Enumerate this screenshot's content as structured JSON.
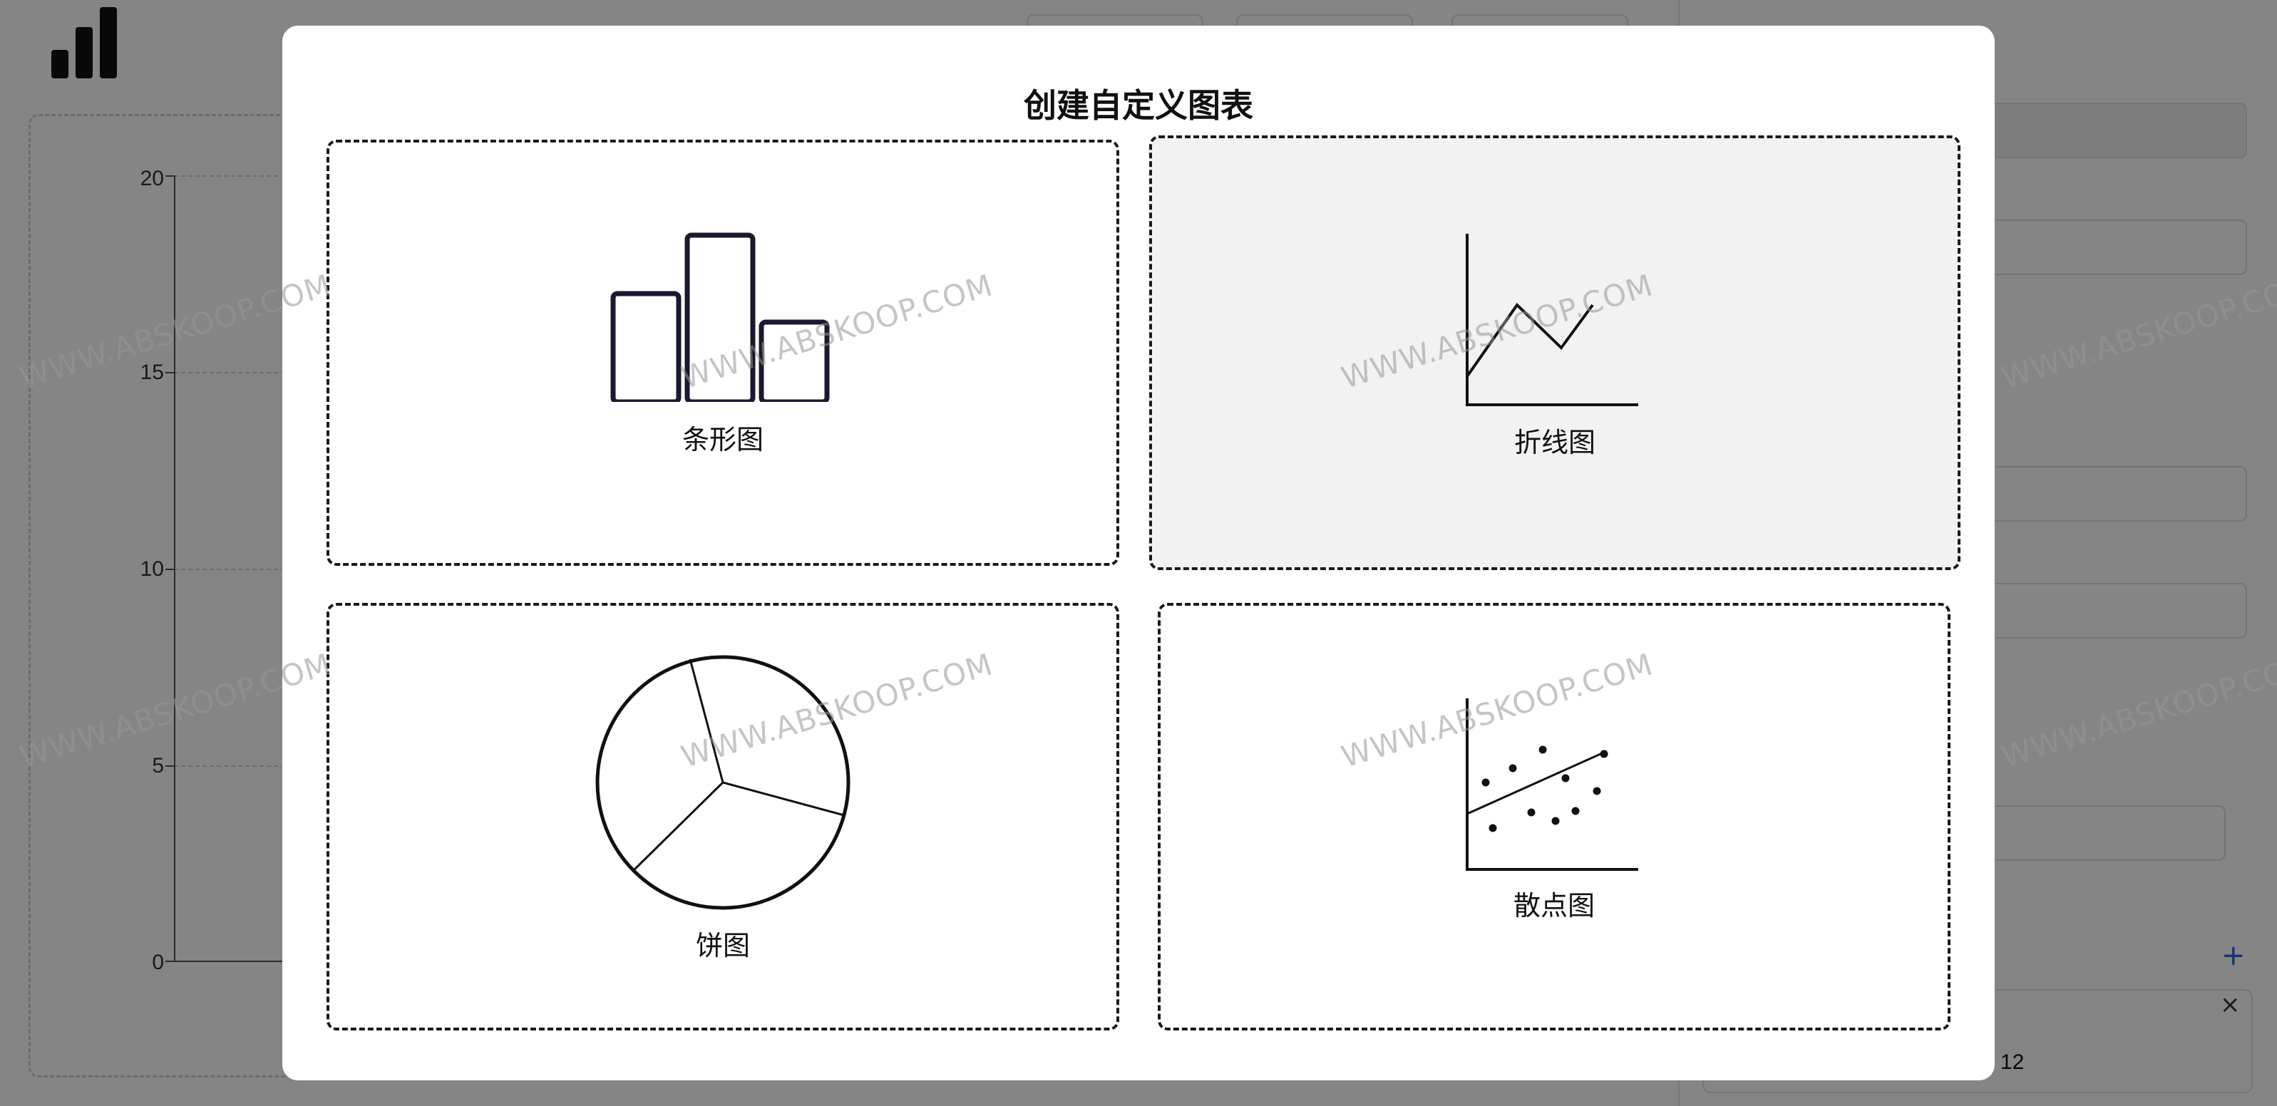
{
  "app": {
    "logo_icon": "bar-chart-logo-icon",
    "y_ticks": [
      "20",
      "15",
      "10",
      "5",
      "0"
    ]
  },
  "right_panel": {
    "add_icon": "+",
    "remove_icon": "×",
    "value": "12"
  },
  "modal": {
    "title": "创建自定义图表",
    "options": [
      {
        "label": "条形图",
        "icon": "bar-chart-icon"
      },
      {
        "label": "折线图",
        "icon": "line-chart-icon"
      },
      {
        "label": "饼图",
        "icon": "pie-chart-icon"
      },
      {
        "label": "散点图",
        "icon": "scatter-chart-icon"
      }
    ]
  },
  "watermark": "WWW.ABSKOOP.COM",
  "colors": {
    "stroke": "#1a1a2e",
    "hover_bg": "#f2f2f2",
    "accent": "#2563eb"
  }
}
